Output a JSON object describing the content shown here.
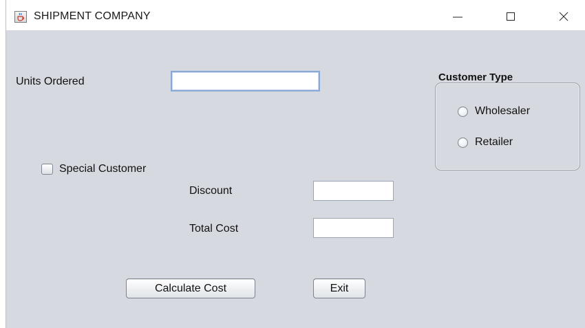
{
  "window": {
    "title": "SHIPMENT COMPANY",
    "icon": "java-cup-icon",
    "controls": [
      "minimize-icon",
      "maximize-icon",
      "close-icon"
    ]
  },
  "form": {
    "units_label": "Units Ordered",
    "units_value": "",
    "special_customer_label": "Special Customer",
    "special_customer_checked": false,
    "discount_label": "Discount",
    "discount_value": "",
    "total_cost_label": "Total Cost",
    "total_cost_value": ""
  },
  "customer_type": {
    "title": "Customer Type",
    "options": [
      {
        "label": "Wholesaler",
        "selected": false
      },
      {
        "label": "Retailer",
        "selected": false
      }
    ]
  },
  "buttons": {
    "calculate": "Calculate Cost",
    "exit": "Exit"
  },
  "colors": {
    "panel_background": "#d6d9df",
    "titlebar_background": "#ffffff",
    "focus_border": "#8aa8d6"
  }
}
